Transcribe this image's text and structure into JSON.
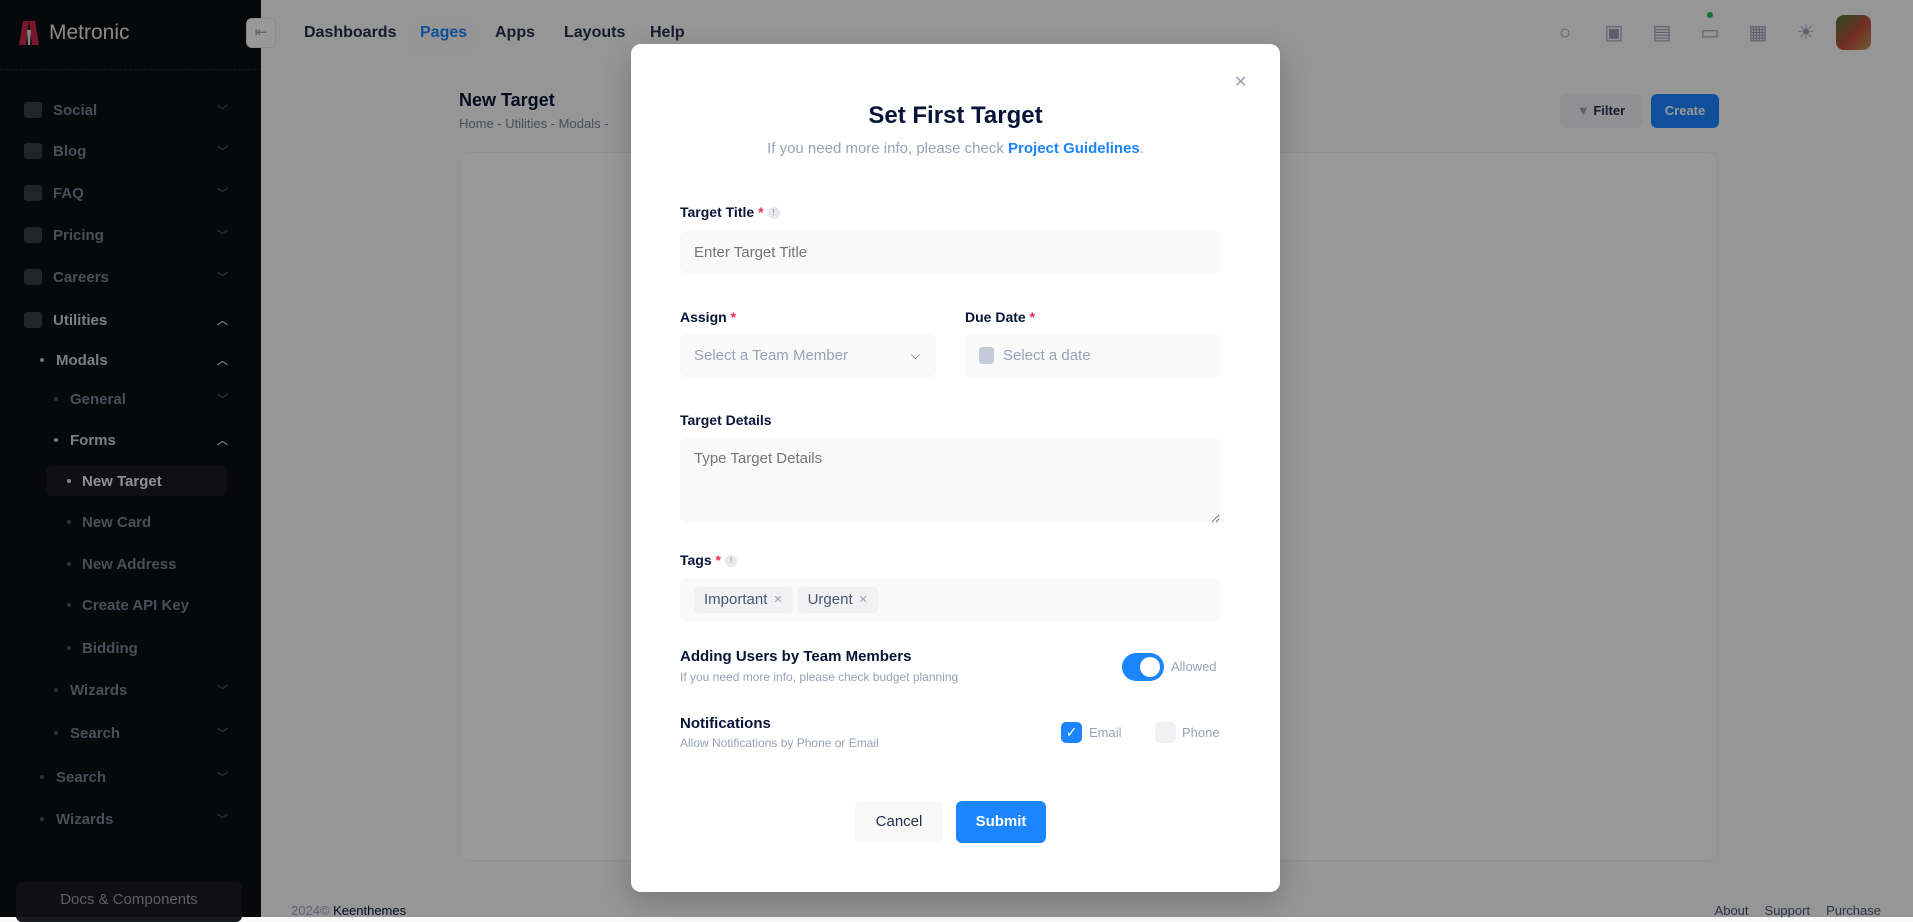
{
  "brand": {
    "name": "Metronic"
  },
  "sidebar": {
    "items": [
      {
        "label": "Social",
        "level": 0,
        "icon": "social-icon",
        "state": "closed"
      },
      {
        "label": "Blog",
        "level": 0,
        "icon": "blog-icon",
        "state": "closed"
      },
      {
        "label": "FAQ",
        "level": 0,
        "icon": "faq-icon",
        "state": "closed"
      },
      {
        "label": "Pricing",
        "level": 0,
        "icon": "pricing-icon",
        "state": "closed"
      },
      {
        "label": "Careers",
        "level": 0,
        "icon": "careers-icon",
        "state": "closed"
      },
      {
        "label": "Utilities",
        "level": 0,
        "icon": "utilities-icon",
        "state": "open"
      },
      {
        "label": "Modals",
        "level": 1,
        "state": "open"
      },
      {
        "label": "General",
        "level": 2,
        "state": "closed"
      },
      {
        "label": "Forms",
        "level": 2,
        "state": "open"
      },
      {
        "label": "New Target",
        "level": 3,
        "state": "active"
      },
      {
        "label": "New Card",
        "level": 3,
        "state": "leaf"
      },
      {
        "label": "New Address",
        "level": 3,
        "state": "leaf"
      },
      {
        "label": "Create API Key",
        "level": 3,
        "state": "leaf"
      },
      {
        "label": "Bidding",
        "level": 3,
        "state": "leaf"
      },
      {
        "label": "Wizards",
        "level": 2,
        "state": "closed"
      },
      {
        "label": "Search",
        "level": 2,
        "state": "closed"
      },
      {
        "label": "Search",
        "level": 1,
        "state": "closed"
      },
      {
        "label": "Wizards",
        "level": 1,
        "state": "closed"
      }
    ],
    "docs_label": "Docs & Components"
  },
  "topnav": {
    "items": [
      "Dashboards",
      "Pages",
      "Apps",
      "Layouts",
      "Help"
    ],
    "active": "Pages"
  },
  "page": {
    "title": "New Target",
    "breadcrumb": "Home - Utilities - Modals -",
    "filter_label": "Filter",
    "create_label": "Create"
  },
  "footer": {
    "year": "2024©",
    "company": "Keenthemes",
    "links": [
      "About",
      "Support",
      "Purchase"
    ]
  },
  "modal": {
    "title": "Set First Target",
    "subtitle": "If you need more info, please check ",
    "subtitle_link": "Project Guidelines",
    "subtitle_end": ".",
    "target_title": {
      "label": "Target Title",
      "placeholder": "Enter Target Title",
      "value": ""
    },
    "assign": {
      "label": "Assign",
      "placeholder": "Select a Team Member"
    },
    "due_date": {
      "label": "Due Date",
      "placeholder": "Select a date"
    },
    "details": {
      "label": "Target Details",
      "placeholder": "Type Target Details"
    },
    "tags": {
      "label": "Tags",
      "items": [
        "Important",
        "Urgent"
      ]
    },
    "adding_users": {
      "title": "Adding Users by Team Members",
      "desc": "If you need more info, please check budget planning",
      "toggle_label": "Allowed",
      "enabled": true
    },
    "notifications": {
      "title": "Notifications",
      "desc": "Allow Notifications by Phone or Email",
      "email_label": "Email",
      "email_checked": true,
      "phone_label": "Phone",
      "phone_checked": false
    },
    "cancel_label": "Cancel",
    "submit_label": "Submit",
    "required_mark": "*"
  },
  "colors": {
    "primary": "#1b84ff",
    "sidebar": "#0d0e12",
    "required": "#f8285a"
  }
}
